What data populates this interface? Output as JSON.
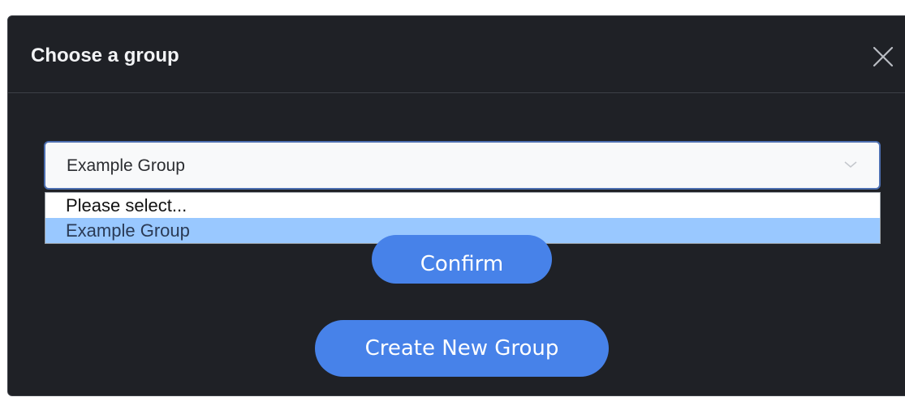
{
  "dialog": {
    "title": "Choose a group",
    "close_icon": "close-icon"
  },
  "group_select": {
    "selected_value": "Example Group",
    "chevron_icon": "chevron-down-icon",
    "options": [
      {
        "label": "Please select...",
        "highlighted": false
      },
      {
        "label": "Example Group",
        "highlighted": true
      }
    ]
  },
  "buttons": {
    "confirm_label": "Confirm",
    "create_label": "Create New Group"
  },
  "colors": {
    "dialog_background": "#1f2126",
    "button_accent": "#4782e9",
    "option_highlight": "#99c8ff"
  }
}
